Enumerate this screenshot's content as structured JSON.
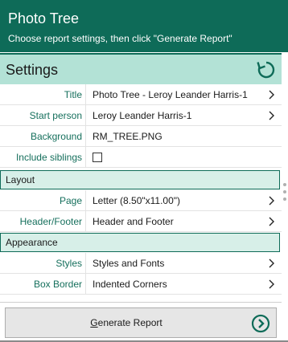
{
  "header": {
    "title": "Photo Tree",
    "subtitle": "Choose report settings, then click \"Generate Report\""
  },
  "settings": {
    "label": "Settings",
    "rows": [
      {
        "label": "Title",
        "value": "Photo Tree - Leroy Leander Harris-1"
      },
      {
        "label": "Start person",
        "value": "Leroy Leander Harris-1"
      },
      {
        "label": "Background",
        "value": "RM_TREE.PNG"
      },
      {
        "label": "Include siblings",
        "value": ""
      }
    ]
  },
  "layout": {
    "label": "Layout",
    "rows": [
      {
        "label": "Page",
        "value": "Letter (8.50\"x11.00\")"
      },
      {
        "label": "Header/Footer",
        "value": "Header and Footer"
      }
    ]
  },
  "appearance": {
    "label": "Appearance",
    "rows": [
      {
        "label": "Styles",
        "value": "Styles and Fonts"
      },
      {
        "label": "Box Border",
        "value": "Indented Corners"
      }
    ]
  },
  "generate": {
    "mnemonic": "G",
    "rest": "enerate Report"
  },
  "colors": {
    "header_bg": "#0e6b58",
    "settings_bg": "#b3e2d6",
    "section_bg": "#d7efe8",
    "label_color": "#156f5c"
  },
  "icons": {
    "reset": "reset-icon",
    "chevron": "chevron-right-icon",
    "go": "arrow-circle-right-icon"
  }
}
